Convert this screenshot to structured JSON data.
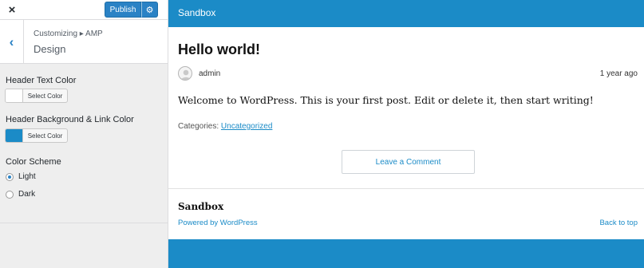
{
  "customizer": {
    "close_icon": "×",
    "publish_label": "Publish",
    "settings_icon": "⚙",
    "back_icon": "‹",
    "breadcrumb": "Customizing ▸ AMP",
    "section_title": "Design",
    "controls": {
      "header_text_color": {
        "label": "Header Text Color",
        "button": "Select Color",
        "value": "#ffffff"
      },
      "header_bg_color": {
        "label": "Header Background & Link Color",
        "button": "Select Color",
        "value": "#1b8bc7"
      },
      "color_scheme": {
        "label": "Color Scheme",
        "options": [
          "Light",
          "Dark"
        ],
        "selected": "Light"
      }
    }
  },
  "preview": {
    "site_title": "Sandbox",
    "post_title": "Hello world!",
    "author": "admin",
    "date": "1 year ago",
    "body": "Welcome to WordPress. This is your first post. Edit or delete it, then start writing!",
    "categories_label": "Categories:",
    "category": "Uncategorized",
    "comment_button": "Leave a Comment",
    "footer_title": "Sandbox",
    "powered_by": "Powered by WordPress",
    "back_to_top": "Back to top"
  },
  "colors": {
    "accent": "#2a82c5",
    "header_bg": "#1b8bc7",
    "sidebar_bg": "#eeeeee"
  }
}
